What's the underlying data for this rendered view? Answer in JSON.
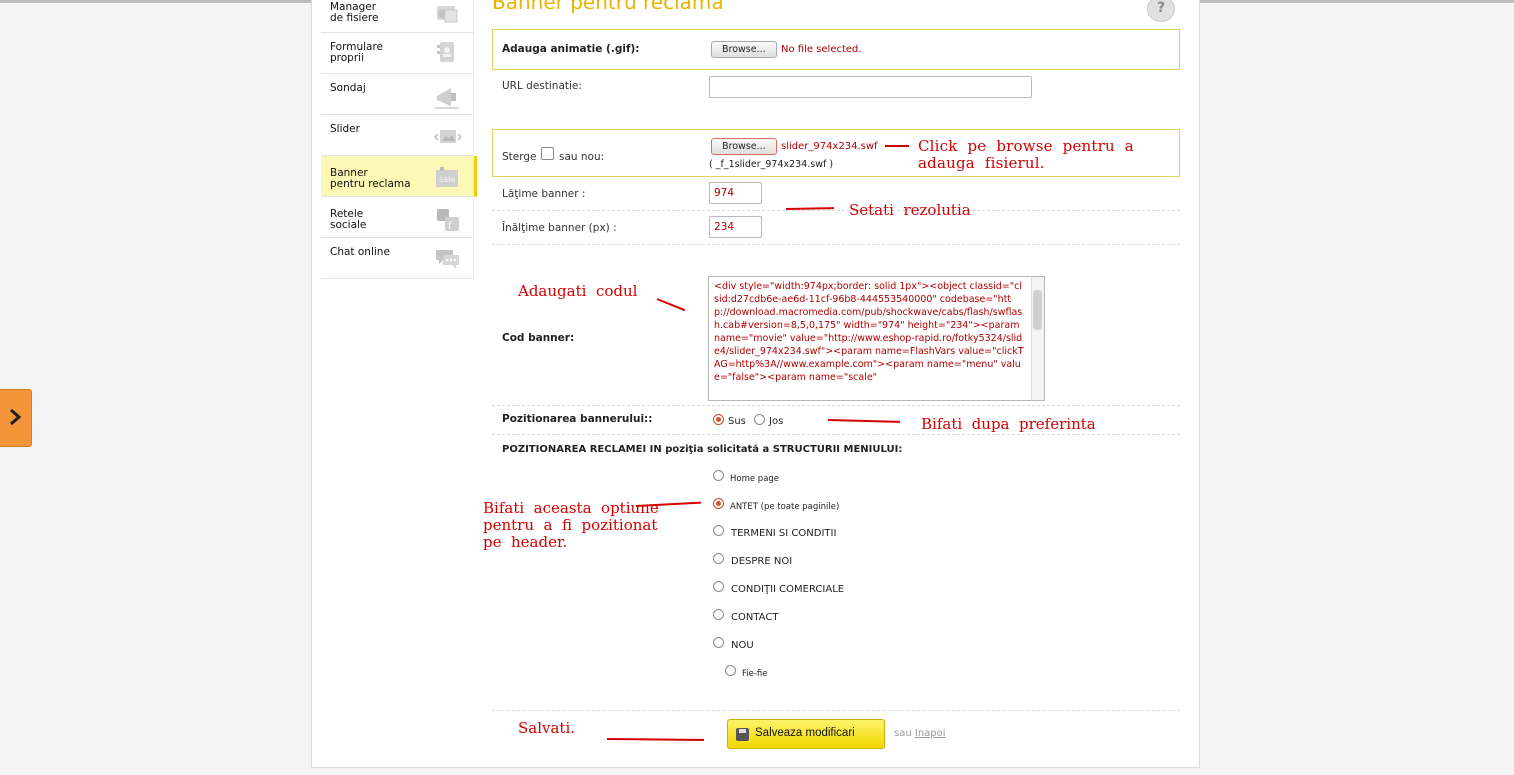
{
  "page_title": "Banner pentru reclama",
  "sidebar": {
    "items": [
      {
        "label": "Manager\nde fisiere",
        "icon": "file-manager-icon"
      },
      {
        "label": "Formulare\nproprii",
        "icon": "forms-icon"
      },
      {
        "label": "Sondaj",
        "icon": "megaphone-icon"
      },
      {
        "label": "Slider",
        "icon": "slider-icon"
      },
      {
        "label": "Banner\npentru reclama",
        "icon": "sale-banner-icon"
      },
      {
        "label": "Retele\nsociale",
        "icon": "social-icon"
      },
      {
        "label": "Chat online",
        "icon": "chat-icon"
      }
    ]
  },
  "form": {
    "gif_label": "Adauga animatie (.gif):",
    "browse_label": "Browse...",
    "no_file": "No file selected.",
    "url_label": "URL destinatie:",
    "url_value": "",
    "sterge_label": "Sterge",
    "sau_nou_label": "sau nou:",
    "swf_file": "slider_974x234.swf",
    "swf_current": "( _f_1slider_974x234.swf )",
    "width_label": "Lăţime banner :",
    "width_value": "974",
    "height_label": "Înălţime banner (px) :",
    "height_value": "234",
    "code_label": "Cod banner:",
    "code_value": "<div style=\"width:974px;border: solid 1px\"><object classid=\"clsid:d27cdb6e-ae6d-11cf-96b8-444553540000\" codebase=\"http://download.macromedia.com/pub/shockwave/cabs/flash/swflash.cab#version=8,5,0,175\" width=\"974\" height=\"234\"><param name=\"movie\" value=\"http://www.eshop-rapid.ro/fotky5324/slide4/slider_974x234.swf\"><param name=FlashVars value=\"clickTAG=http%3A//www.example.com\"><param name=\"menu\" value=\"false\"><param name=\"scale\"",
    "position_label": "Pozitionarea bannerului::",
    "position_options": [
      "Sus",
      "Jos"
    ],
    "placement_heading": "POZITIONAREA RECLAMEI IN poziţia solicitată a STRUCTURII MENIULUI:",
    "placement_options": [
      {
        "label": "Home page",
        "small": true,
        "checked": false
      },
      {
        "label": "ANTET (pe toate paginile)",
        "small": true,
        "checked": true
      },
      {
        "label": "TERMENI SI CONDITII",
        "small": false,
        "checked": false
      },
      {
        "label": "DESPRE NOI",
        "small": false,
        "checked": false
      },
      {
        "label": "CONDIŢII COMERCIALE",
        "small": false,
        "checked": false
      },
      {
        "label": "CONTACT",
        "small": false,
        "checked": false
      },
      {
        "label": "NOU",
        "small": false,
        "checked": false
      },
      {
        "label": "Fie-fie",
        "small": true,
        "checked": false
      }
    ],
    "save_label": "Salveaza modificari",
    "or_label": "sau",
    "back_label": "Inapoi"
  },
  "annotations": {
    "browse": "Click  pe  browse  pentru  a\nadauga  fisierul.",
    "resolution": "Setati  rezolutia",
    "code": "Adaugati  codul",
    "preference": "Bifati  dupa  preferinta",
    "header_option": "Bifati  aceasta  optiune\npentru  a  fi  pozitionat\npe  header.",
    "save": "Salvati."
  },
  "colors": {
    "accent_yellow": "#f1d800",
    "box_border": "#e3d25a",
    "annotation_red": "#d40000",
    "value_red": "#b00000",
    "side_tab_orange": "#f5953a"
  }
}
